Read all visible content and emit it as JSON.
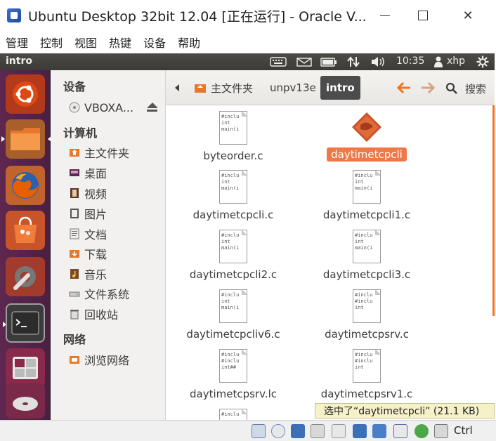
{
  "window": {
    "title": "Ubuntu Desktop 32bit 12.04 [正在运行] - Oracle V...",
    "min_label": "–",
    "close_label": "✕"
  },
  "menubar": [
    "管理",
    "控制",
    "视图",
    "热键",
    "设备",
    "帮助"
  ],
  "panel": {
    "app_name": "intro",
    "time": "10:35",
    "user": "xhp",
    "indicators": [
      "keyboard-icon",
      "mail-icon",
      "battery-icon",
      "network-icon",
      "volume-icon",
      "user-icon",
      "gear-icon"
    ]
  },
  "launcher": [
    "ubuntu-dash",
    "files",
    "firefox",
    "software-center",
    "system-settings",
    "terminal",
    "workspace-switcher",
    "disc"
  ],
  "sidebar": {
    "devices_header": "设备",
    "devices": [
      {
        "label": "VBOXA...",
        "icon": "disc-icon"
      }
    ],
    "computer_header": "计算机",
    "places": [
      {
        "label": "主文件夹",
        "icon": "home-folder-icon"
      },
      {
        "label": "桌面",
        "icon": "desktop-icon"
      },
      {
        "label": "视频",
        "icon": "video-icon"
      },
      {
        "label": "图片",
        "icon": "picture-icon"
      },
      {
        "label": "文档",
        "icon": "documents-icon"
      },
      {
        "label": "下载",
        "icon": "download-icon"
      },
      {
        "label": "音乐",
        "icon": "music-icon"
      },
      {
        "label": "文件系统",
        "icon": "filesystem-icon"
      },
      {
        "label": "回收站",
        "icon": "trash-icon"
      }
    ],
    "network_header": "网络",
    "network": [
      {
        "label": "浏览网络",
        "icon": "network-icon"
      }
    ]
  },
  "toolbar": {
    "breadcrumbs": [
      "主文件夹",
      "unpv13e",
      "intro"
    ],
    "search_label": "搜索"
  },
  "files": [
    {
      "name": "byteorder.c",
      "type": "c",
      "preview": [
        "#inclu",
        "",
        "int",
        "main(i"
      ],
      "selected": false
    },
    {
      "name": "daytimetcpcli",
      "type": "exec",
      "preview": [],
      "selected": true
    },
    {
      "name": "daytimetcpcli.c",
      "type": "c",
      "preview": [
        "#inclu",
        "",
        "int",
        "main(i"
      ],
      "selected": false
    },
    {
      "name": "daytimetcpcli1.c",
      "type": "c",
      "preview": [
        "#inclu",
        "",
        "int",
        "main(i"
      ],
      "selected": false
    },
    {
      "name": "daytimetcpcli2.c",
      "type": "c",
      "preview": [
        "#inclu",
        "",
        "int",
        "main(i"
      ],
      "selected": false
    },
    {
      "name": "daytimetcpcli3.c",
      "type": "c",
      "preview": [
        "#inclu",
        "",
        "int",
        "main(i"
      ],
      "selected": false
    },
    {
      "name": "daytimetcpcliv6.c",
      "type": "c",
      "preview": [
        "#inclu",
        "",
        "int",
        "main(i"
      ],
      "selected": false
    },
    {
      "name": "daytimetcpsrv.c",
      "type": "c",
      "preview": [
        "#inclu",
        "#inclu",
        "",
        "int"
      ],
      "selected": false
    },
    {
      "name": "daytimetcpsrv.lc",
      "type": "c",
      "preview": [
        "#inclu",
        "#inclu",
        "",
        "int##"
      ],
      "selected": false
    },
    {
      "name": "daytimetcpsrv1.c",
      "type": "c",
      "preview": [
        "#inclu",
        "#inclu",
        "",
        "int"
      ],
      "selected": false
    },
    {
      "name": "",
      "type": "c",
      "preview": [
        "#inclu"
      ],
      "selected": false
    }
  ],
  "status": {
    "text": "选中了“daytimetcpcli” (21.1 KB)"
  },
  "vbox": {
    "ctrl_label": "Ctrl"
  },
  "colors": {
    "selection": "#f07746",
    "launcher": "#5e2750",
    "panel": "#3c3b37",
    "accent": "#f47421"
  }
}
